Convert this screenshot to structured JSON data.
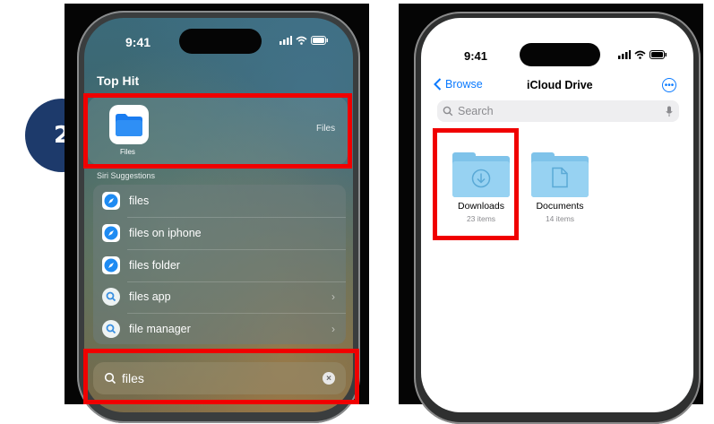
{
  "step": {
    "number": "2"
  },
  "left": {
    "status": {
      "time": "9:41"
    },
    "top_hit": {
      "title": "Top Hit",
      "app_label": "Files",
      "category": "Files"
    },
    "siri": {
      "title": "Siri Suggestions",
      "items": [
        {
          "label": "files",
          "icon": "safari-icon"
        },
        {
          "label": "files on iphone",
          "icon": "safari-icon"
        },
        {
          "label": "files folder",
          "icon": "safari-icon"
        },
        {
          "label": "files app",
          "icon": "search-icon"
        },
        {
          "label": "file manager",
          "icon": "search-icon"
        }
      ]
    },
    "search": {
      "value": "files"
    }
  },
  "right": {
    "status": {
      "time": "9:41"
    },
    "nav": {
      "back_label": "Browse",
      "title": "iCloud Drive"
    },
    "search": {
      "placeholder": "Search"
    },
    "folders": [
      {
        "name": "Downloads",
        "count": "23 items",
        "icon": "download-icon"
      },
      {
        "name": "Documents",
        "count": "14 items",
        "icon": "document-icon"
      }
    ]
  },
  "colors": {
    "highlight": "#f00000",
    "badge": "#1d3a6b",
    "ios_blue": "#0a7aff",
    "folder": "#7fc3ea"
  }
}
